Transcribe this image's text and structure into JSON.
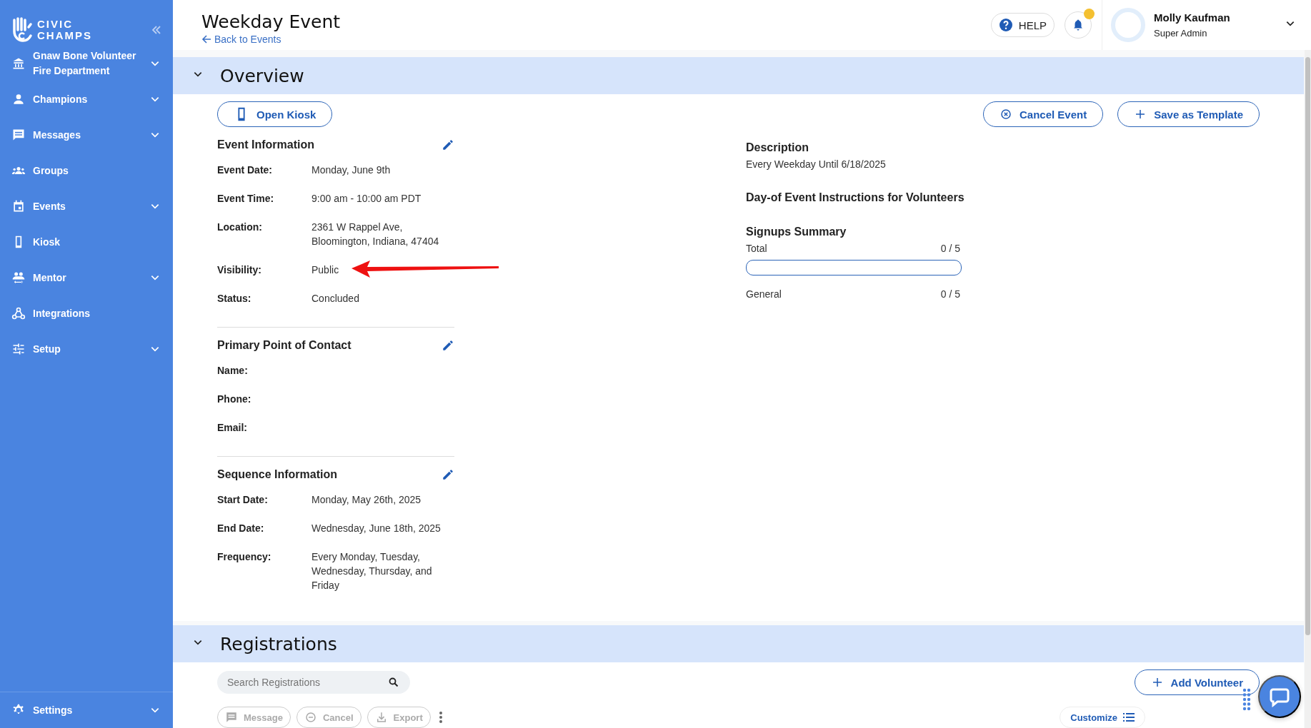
{
  "sidebar": {
    "logo": {
      "line1": "CIVIC",
      "line2": "CHAMPS"
    },
    "items": [
      {
        "label": "Gnaw Bone Volunteer Fire Department",
        "expandable": true
      },
      {
        "label": "Champions",
        "expandable": true
      },
      {
        "label": "Messages",
        "expandable": true
      },
      {
        "label": "Groups",
        "expandable": false
      },
      {
        "label": "Events",
        "expandable": true
      },
      {
        "label": "Kiosk",
        "expandable": false
      },
      {
        "label": "Mentor",
        "expandable": true
      },
      {
        "label": "Integrations",
        "expandable": false
      },
      {
        "label": "Setup",
        "expandable": true
      }
    ],
    "footer": {
      "label": "Settings",
      "expandable": true
    }
  },
  "header": {
    "title": "Weekday Event",
    "back_link": "Back to Events",
    "help": "HELP",
    "notification_badge": true,
    "user": {
      "name": "Molly Kaufman",
      "role": "Super Admin"
    }
  },
  "overview": {
    "title": "Overview",
    "expanded": true,
    "open_kiosk": "Open Kiosk",
    "actions": [
      "Cancel Event",
      "Save as Template"
    ],
    "sections": [
      {
        "title": "Event Information",
        "fields": [
          {
            "label": "Event Date:",
            "value": [
              "Monday, June 9th"
            ],
            "marked": false
          },
          {
            "label": "Event Time:",
            "value": [
              "9:00 am - 10:00 am PDT"
            ],
            "marked": false
          },
          {
            "label": "Location:",
            "value": [
              "2361 W Rappel Ave,",
              "Bloomington, Indiana, 47404"
            ],
            "marked": false
          },
          {
            "label": "Visibility:",
            "value": [
              "Public"
            ],
            "marked": true
          },
          {
            "label": "Status:",
            "value": [
              "Concluded"
            ],
            "marked": false
          }
        ]
      },
      {
        "title": "Primary Point of Contact",
        "fields": [
          {
            "label": "Name:",
            "marked": false
          },
          {
            "label": "Phone:",
            "marked": false
          },
          {
            "label": "Email:",
            "marked": false
          }
        ]
      },
      {
        "title": "Sequence Information",
        "fields": [
          {
            "label": "Start Date:",
            "value": [
              "Monday, May 26th, 2025"
            ],
            "marked": false
          },
          {
            "label": "End Date:",
            "value": [
              "Wednesday, June 18th, 2025"
            ],
            "marked": false
          },
          {
            "label": "Frequency:",
            "value": [
              "Every Monday, Tuesday,",
              "Wednesday, Thursday, and",
              "Friday"
            ],
            "marked": false
          }
        ]
      }
    ],
    "description": {
      "title": "Description",
      "text": "Every Weekday Until 6/18/2025"
    },
    "instructions_title": "Day-of Event Instructions for Volunteers",
    "signups": {
      "title": "Signups Summary",
      "total": {
        "label": "Total",
        "count": "0 / 5",
        "level": 0
      },
      "rows": [
        {
          "label": "General",
          "count": "0 / 5"
        }
      ]
    }
  },
  "registrations": {
    "title": "Registrations",
    "expanded": true,
    "search_placeholder": "Search Registrations",
    "add_button": "Add Volunteer",
    "toolbar": [
      {
        "label": "Message",
        "disabled": true
      },
      {
        "label": "Cancel",
        "disabled": true
      },
      {
        "label": "Export",
        "disabled": true
      }
    ],
    "customize": "Customize"
  }
}
